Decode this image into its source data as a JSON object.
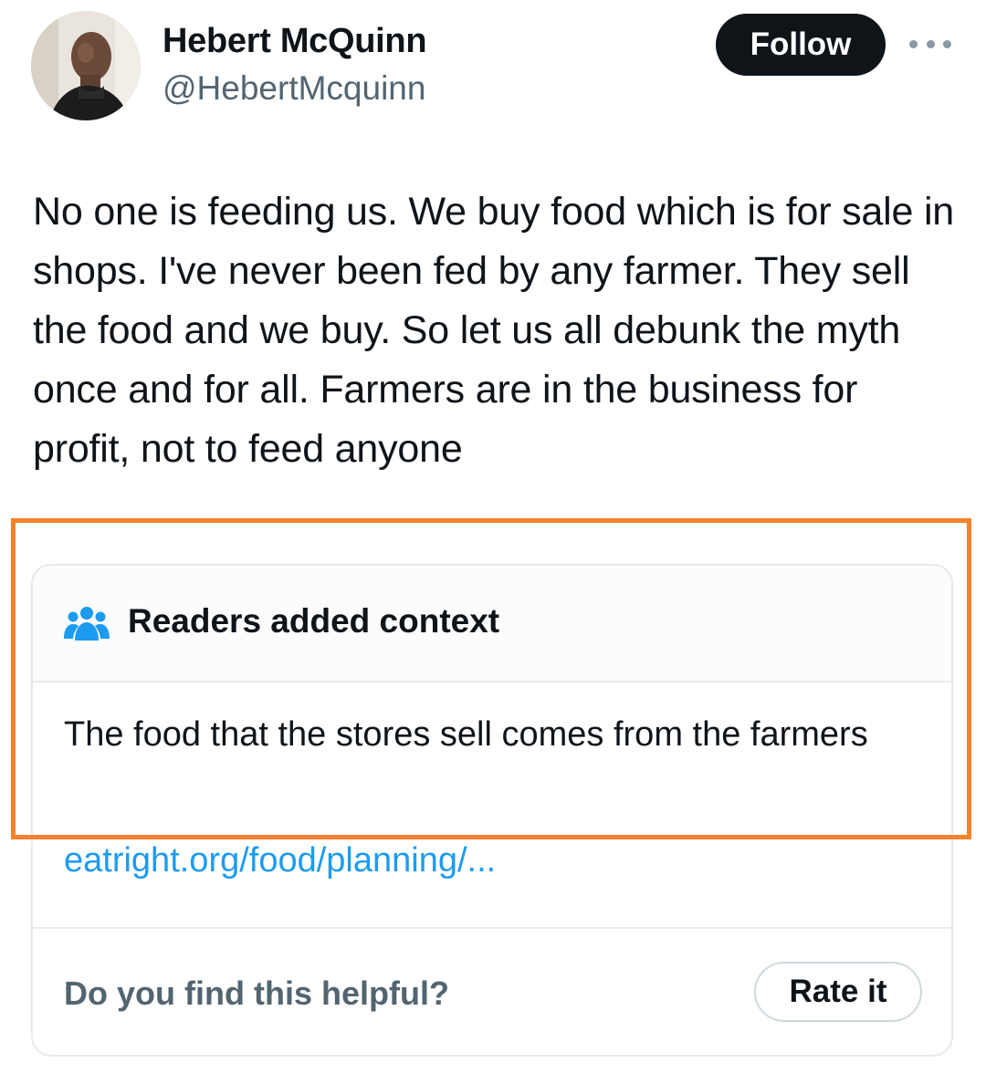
{
  "author": {
    "name": "Hebert McQuinn",
    "handle": "@HebertMcquinn"
  },
  "header": {
    "follow_label": "Follow",
    "more_icon": "more-horizontal-icon"
  },
  "tweet": {
    "text": "No one is feeding us. We buy food which is for sale in shops. I've never been fed by any farmer. They sell the food and we buy. So let us all debunk the myth once and for all. Farmers are in the business for profit, not to feed anyone"
  },
  "community_note": {
    "icon": "people-icon",
    "title": "Readers added context",
    "body": "The food that the stores sell comes from the farmers",
    "link": "eatright.org/food/planning/...",
    "helpful_question": "Do you find this helpful?",
    "rate_label": "Rate it"
  },
  "colors": {
    "accent_link": "#1d9bf0",
    "follow_button_bg": "#0f1419",
    "highlight_border": "#f5822a",
    "secondary_text": "#536471"
  }
}
